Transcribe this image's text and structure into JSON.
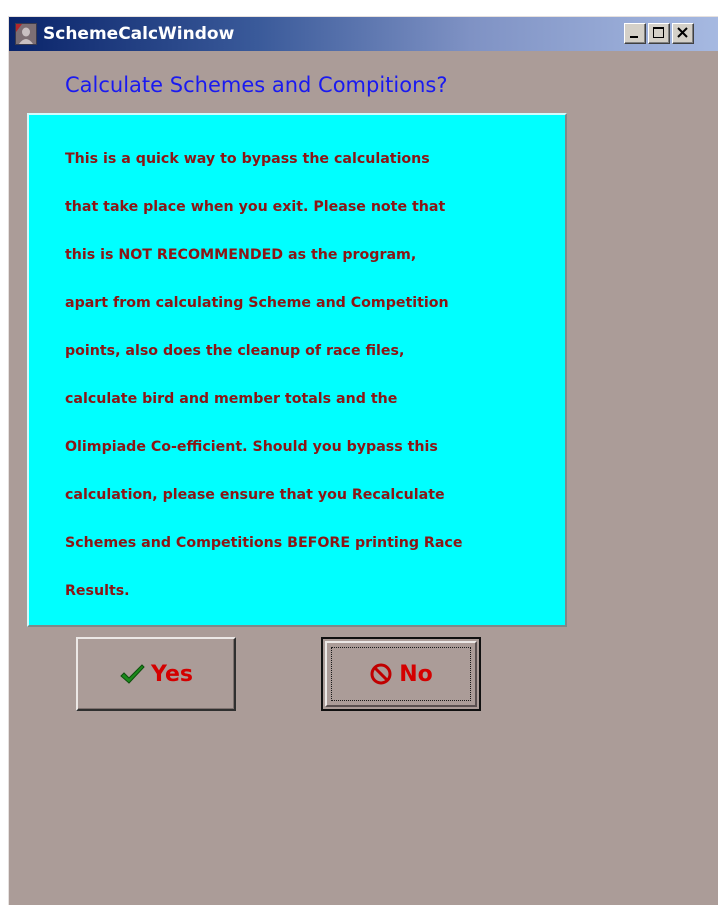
{
  "window": {
    "title": "SchemeCalcWindow"
  },
  "dialog": {
    "heading": "Calculate Schemes and Compitions?",
    "message_lines": [
      "This is a quick way to bypass the calculations",
      "that take place when you exit. Please note that",
      "this is NOT RECOMMENDED as the program,",
      "apart from calculating Scheme and Competition",
      "points, also  does the cleanup of race files,",
      "calculate bird and member totals and the",
      "Olimpiade Co-efficient.  Should you bypass this",
      "calculation, please ensure that you Recalculate",
      "Schemes and Competitions BEFORE printing Race",
      "Results."
    ],
    "yes_label": "Yes",
    "no_label": "No"
  },
  "icons": {
    "app": "app-icon",
    "minimize": "minimize-icon",
    "maximize": "maximize-icon",
    "close": "close-icon",
    "yes": "checkmark-icon",
    "no": "no-sign-icon"
  },
  "colors": {
    "title_bar_start": "#0a246a",
    "title_bar_end": "#a6b9e1",
    "window_bg": "#ab9c98",
    "heading": "#1a1af0",
    "panel_bg": "#00ffff",
    "message_text": "#8b1515",
    "button_text": "#d40000",
    "check": "#1a8a1a"
  }
}
